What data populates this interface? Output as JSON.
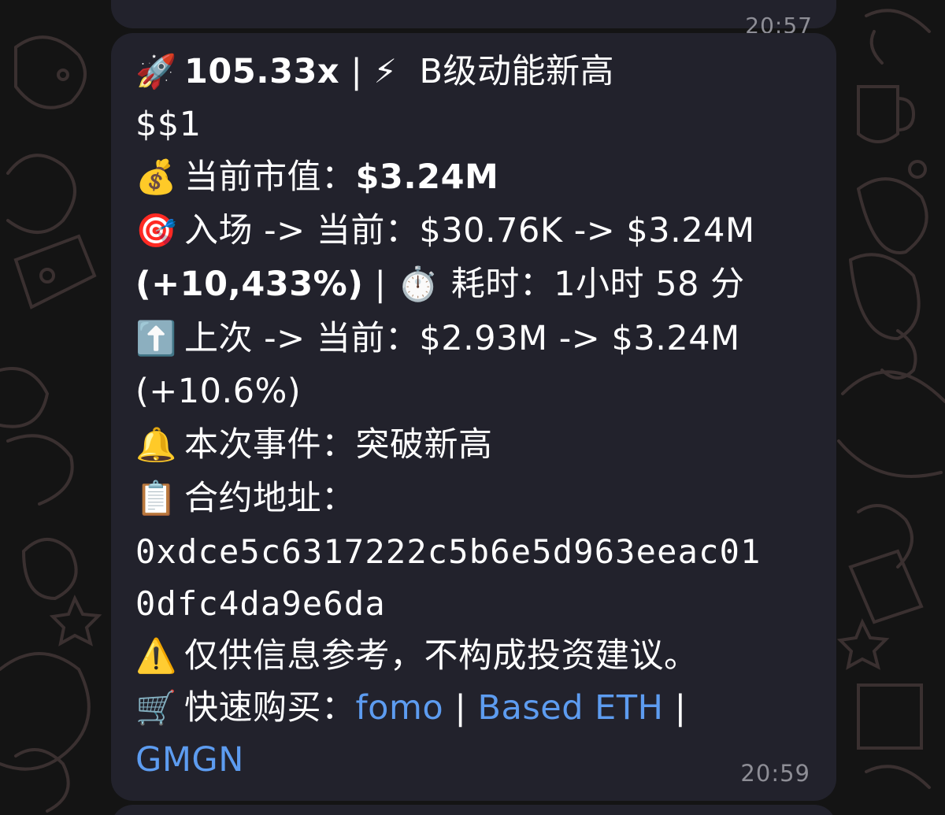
{
  "chat": {
    "previous_message": {
      "time": "20:57"
    },
    "message": {
      "headline": {
        "icon": "rocket-icon",
        "multiplier": "105.33x",
        "separator": "|",
        "icon2": "lightning-icon",
        "level": "B级动能新高"
      },
      "ticker": "$$1",
      "market_cap": {
        "icon": "money-bag-icon",
        "label": "当前市值：",
        "value": "$3.24M"
      },
      "entry_vs_current": {
        "icon": "target-icon",
        "label": "入场 -> 当前：",
        "value": "$30.76K -> $3.24M",
        "change": "(+10,433%)",
        "separator": "|",
        "time_icon": "stopwatch-icon",
        "time_label": "耗时：",
        "time_value": "1小时 58 分"
      },
      "last_vs_current": {
        "icon": "up-arrow-icon",
        "label": "上次 -> 当前：",
        "value": "$2.93M -> $3.24M",
        "change": "(+10.6%)"
      },
      "event": {
        "icon": "bell-icon",
        "label": "本次事件：",
        "value": "突破新高"
      },
      "contract": {
        "icon": "clipboard-icon",
        "label": "合约地址：",
        "address_line1": "0xdce5c6317222c5b6e5d963eeac01",
        "address_line2": "0dfc4da9e6da"
      },
      "disclaimer": {
        "icon": "warning-icon",
        "text": "仅供信息参考，不构成投资建议。"
      },
      "quick_buy": {
        "icon": "shopping-cart-icon",
        "label": "快速购买：",
        "links": [
          "fomo",
          "Based ETH",
          "GMGN"
        ],
        "separator": "|"
      },
      "time": "20:59"
    }
  },
  "colors": {
    "bubble_bg": "#22222c",
    "link": "#5d9cf0",
    "timestamp": "#8e8e96",
    "wallpaper": "#141414"
  }
}
